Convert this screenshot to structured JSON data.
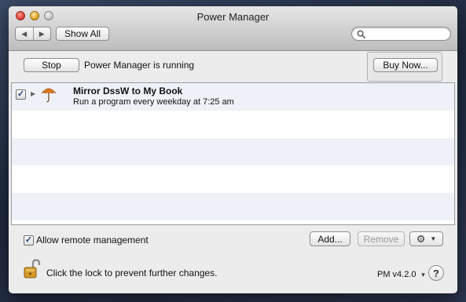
{
  "window": {
    "title": "Power Manager"
  },
  "toolbar": {
    "back_glyph": "◀",
    "forward_glyph": "▶",
    "show_all_label": "Show All",
    "search_placeholder": "",
    "search_icon": "search-icon"
  },
  "control": {
    "stop_label": "Stop",
    "status_text": "Power Manager is running",
    "buy_label": "Buy Now..."
  },
  "events": [
    {
      "enabled": true,
      "name": "Mirror DssW to My Book",
      "description": "Run a program every weekday at 7:25 am",
      "icon": "umbrella-icon",
      "expanded": false
    }
  ],
  "footer": {
    "remote_checked": true,
    "remote_label": "Allow remote management",
    "add_label": "Add...",
    "remove_label": "Remove",
    "gear_icon": "gear-icon",
    "lock_text": "Click the lock to prevent further changes.",
    "version_label": "PM v4.2.0",
    "help_glyph": "?"
  },
  "colors": {
    "row_stripe": "#eef2f8",
    "checkmark": "#1b3f86",
    "lock_body": "#d49a2a"
  }
}
